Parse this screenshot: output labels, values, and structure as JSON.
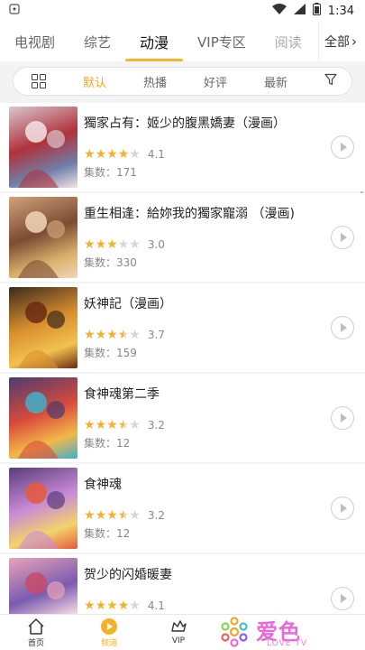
{
  "status_bar": {
    "time": "1:34"
  },
  "tabs": [
    {
      "label": "电视剧",
      "state": "normal"
    },
    {
      "label": "综艺",
      "state": "normal"
    },
    {
      "label": "动漫",
      "state": "active"
    },
    {
      "label": "VIP专区",
      "state": "normal"
    },
    {
      "label": "阅读",
      "state": "faded"
    }
  ],
  "tab_more": {
    "label": "全部"
  },
  "filter": {
    "options": [
      "默认",
      "热播",
      "好评",
      "最新"
    ],
    "active": "默认"
  },
  "items": [
    {
      "title": "獨家占有：姬少的腹黑嬌妻（漫画）",
      "rating": "4.1",
      "stars": [
        "full",
        "full",
        "full",
        "full",
        "empty"
      ],
      "episodes": "集数：171"
    },
    {
      "title": "重生相逢：給妳我的獨家寵溺 （漫画)",
      "rating": "3.0",
      "stars": [
        "full",
        "full",
        "full",
        "empty",
        "empty"
      ],
      "episodes": "集数：330"
    },
    {
      "title": "妖神記（漫画）",
      "rating": "3.7",
      "stars": [
        "full",
        "full",
        "full",
        "half",
        "empty"
      ],
      "episodes": "集数：159"
    },
    {
      "title": "食神魂第二季",
      "rating": "3.2",
      "stars": [
        "full",
        "full",
        "full",
        "half",
        "empty"
      ],
      "episodes": "集数：12"
    },
    {
      "title": "食神魂",
      "rating": "3.2",
      "stars": [
        "full",
        "full",
        "full",
        "half",
        "empty"
      ],
      "episodes": "集数：12"
    },
    {
      "title": "贺少的闪婚暖妻",
      "rating": "4.1",
      "stars": [
        "full",
        "full",
        "full",
        "full",
        "empty"
      ],
      "episodes": ""
    }
  ],
  "bottom_nav": [
    {
      "label": "首页",
      "icon": "home-icon",
      "active": false
    },
    {
      "label": "频道",
      "icon": "play-circle-icon",
      "active": true
    },
    {
      "label": "VIP",
      "icon": "crown-icon",
      "active": false
    }
  ],
  "brand": {
    "text": "爱色",
    "sub": "LOVE TV"
  },
  "colors": {
    "accent": "#f5b52a",
    "star": "#f5b02a",
    "brand": "#e86ad9"
  }
}
